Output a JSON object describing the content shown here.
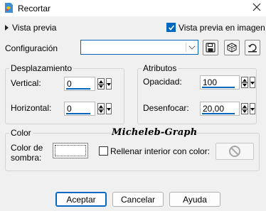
{
  "window": {
    "title": "Recortar",
    "icon": "paint-palette-icon",
    "close_icon": "close-icon"
  },
  "preview": {
    "toggle_label": "Vista previa",
    "toggle_icon": "triangle-right-icon",
    "in_image_label": "Vista previa en imagen",
    "in_image_checked": true
  },
  "config": {
    "label": "Configuración",
    "value": "",
    "save_icon": "save-disk-icon",
    "random_icon": "dice-icon",
    "reset_icon": "reset-icon"
  },
  "desplazamiento": {
    "title": "Desplazamiento",
    "vertical": {
      "label": "Vertical:",
      "value": "0"
    },
    "horizontal": {
      "label": "Horizontal:",
      "value": "0"
    }
  },
  "atributos": {
    "title": "Atributos",
    "opacidad": {
      "label": "Opacidad:",
      "value": "100"
    },
    "desenfocar": {
      "label": "Desenfocar:",
      "value": "20,00"
    }
  },
  "color": {
    "title": "Color",
    "shadow_label_1": "Color de",
    "shadow_label_2": "sombra:",
    "shadow_color": "#ffffff",
    "fill_label": "Rellenar interior con color:",
    "fill_checked": false,
    "fill_icon": "no-symbol-icon"
  },
  "watermark": "Micheleb-Graph",
  "buttons": {
    "ok": "Aceptar",
    "cancel": "Cancelar",
    "help": "Ayuda"
  },
  "colors": {
    "accent": "#0067c0",
    "background": "#f0f0f0"
  }
}
